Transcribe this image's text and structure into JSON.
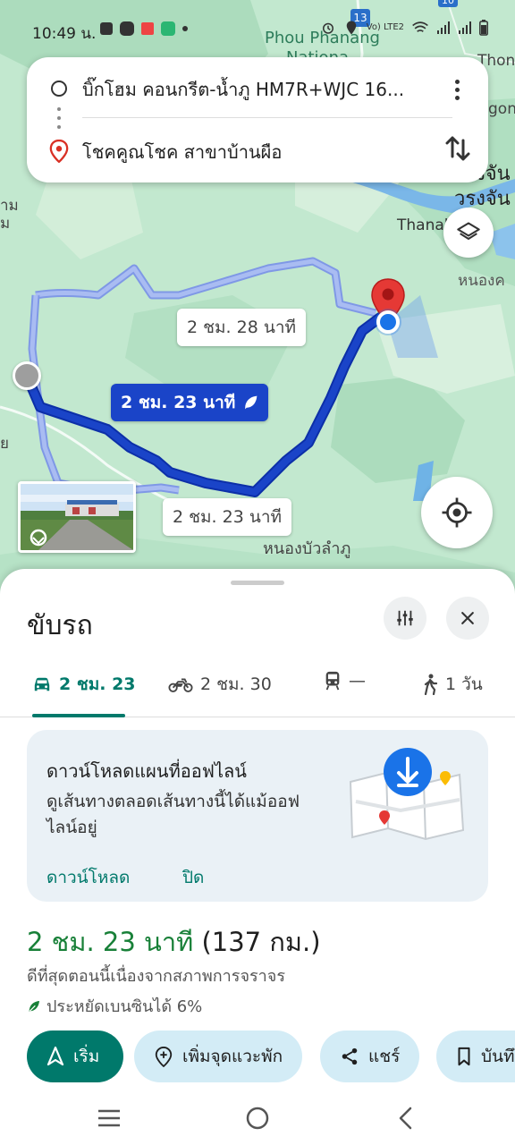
{
  "status_bar": {
    "time": "10:49 น.",
    "network": "Vo) LTE2"
  },
  "map": {
    "labels": {
      "phou_phanang": "Phou Phanang",
      "national": "Nationa",
      "thone": "Thone",
      "gong": "gon",
      "thanaleng": "Thanal",
      "nong_khai": "หนองค",
      "wiang_chan_1": "งจัน",
      "wiang_chan_2": "วรงจัน",
      "nong_bua_lamphu": "หนองบัวลำภู",
      "left_1": "าม",
      "left_2": "ม",
      "left_3": "ย",
      "road_13": "13",
      "road_10": "10"
    },
    "route_labels": {
      "alt_1": "2 ชม. 28 นาที",
      "main": "2 ชม. 23 นาที",
      "alt_2": "2 ชม. 23 นาที"
    },
    "route_color": "#1a44c8",
    "alt_route_color": "#9fb2ee"
  },
  "search": {
    "origin": "บิ๊กโฮม คอนกรีต-น้ำภู HM7R+WJC 16...",
    "destination": "โชคคูณโชค สาขาบ้านผือ"
  },
  "sheet": {
    "title": "ขับรถ",
    "tabs": [
      {
        "mode": "car",
        "label": "2 ชม. 23"
      },
      {
        "mode": "motorcycle",
        "label": "2 ชม. 30"
      },
      {
        "mode": "transit",
        "label": "—"
      },
      {
        "mode": "walk",
        "label": "1 วัน"
      }
    ],
    "offline": {
      "title": "ดาวน์โหลดแผนที่ออฟไลน์",
      "body": "ดูเส้นทางตลอดเส้นทางนี้ได้แม้ออฟไลน์อยู่",
      "download": "ดาวน์โหลด",
      "close": "ปิด"
    },
    "eta": {
      "duration": "2 ชม. 23 นาที",
      "distance": "(137 กม.)",
      "note": "ดีที่สุดตอนนี้เนื่องจากสภาพการจราจร",
      "eco": "ประหยัดเบนซินได้ 6%"
    },
    "actions": {
      "start": "เริ่ม",
      "add_stop": "เพิ่มจุดแวะพัก",
      "share": "แชร์",
      "save": "บันทึก"
    }
  },
  "accent": "#00796b"
}
